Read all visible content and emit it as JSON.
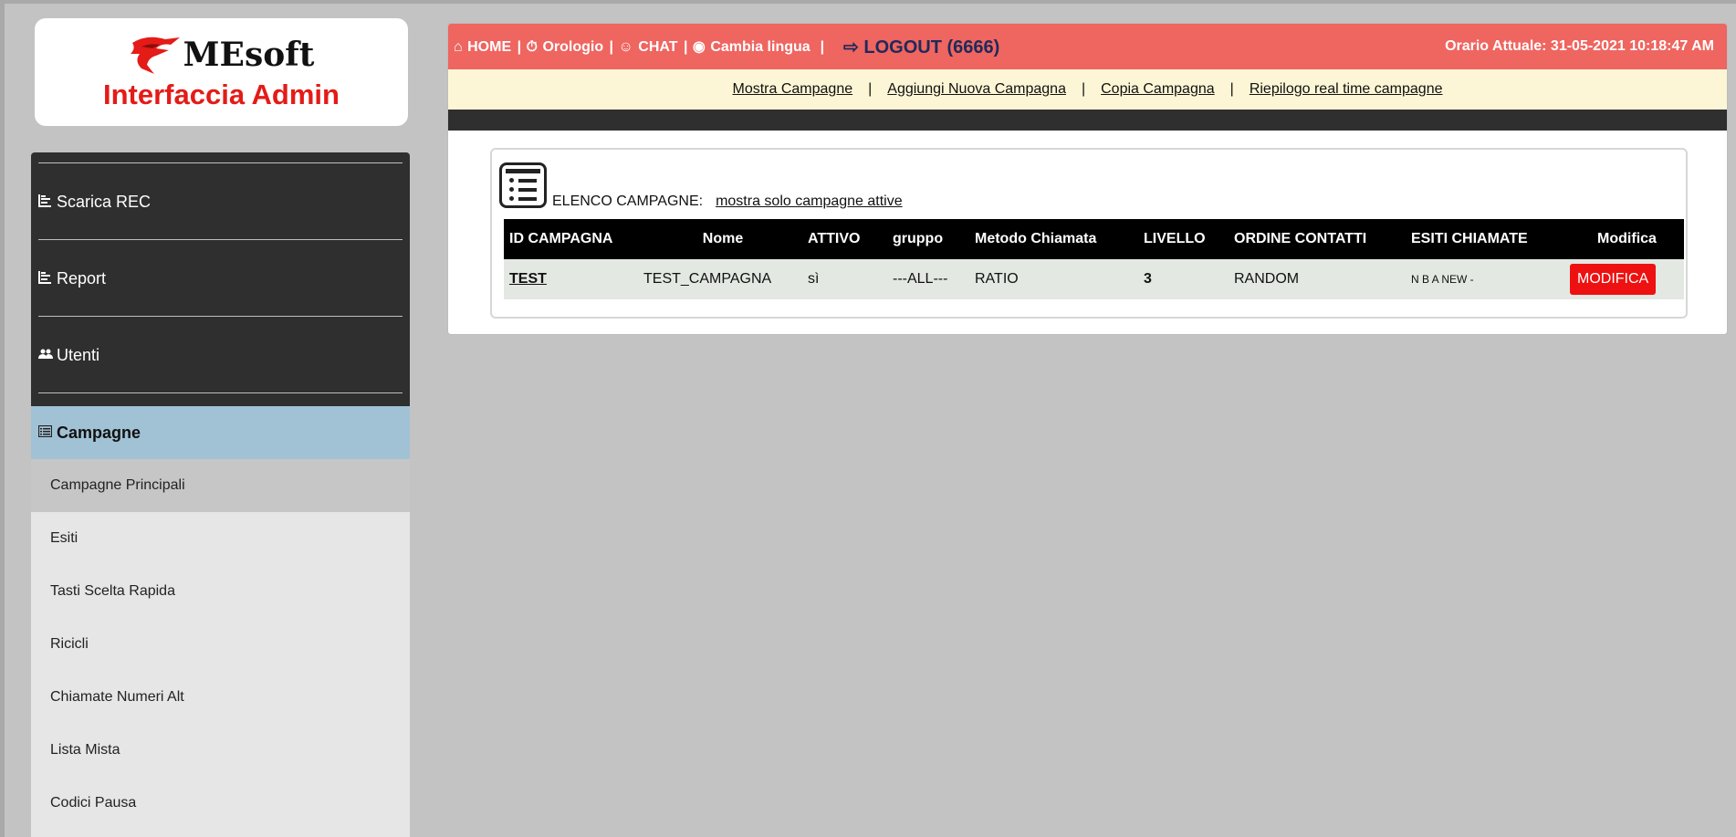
{
  "logo": {
    "brand": "MEsoft",
    "subtitle": "Interfaccia Admin"
  },
  "sidebar": {
    "items": [
      {
        "icon": "chart-icon",
        "label": "Scarica REC"
      },
      {
        "icon": "chart-icon",
        "label": "Report"
      },
      {
        "icon": "users-icon",
        "label": "Utenti"
      }
    ],
    "active": {
      "icon": "list-icon",
      "label": "Campagne"
    },
    "submenu": [
      {
        "label": "Campagne Principali",
        "selected": true
      },
      {
        "label": "Esiti"
      },
      {
        "label": "Tasti Scelta Rapida"
      },
      {
        "label": "Ricicli"
      },
      {
        "label": "Chiamate Numeri Alt"
      },
      {
        "label": "Lista Mista"
      },
      {
        "label": "Codici Pausa"
      }
    ]
  },
  "topbar": {
    "home": "HOME",
    "clock": "Orologio",
    "chat": "CHAT",
    "language": "Cambia lingua",
    "logout": "LOGOUT (6666)",
    "current_time": "Orario Attuale: 31-05-2021 10:18:47 AM"
  },
  "subnav": {
    "show": "Mostra Campagne",
    "add": "Aggiungi Nuova Campagna",
    "copy": "Copia Campagna",
    "summary": "Riepilogo real time campagne",
    "separator": "|"
  },
  "list": {
    "title": "ELENCO CAMPAGNE:",
    "filter": "mostra solo campagne attive",
    "columns": [
      "ID CAMPAGNA",
      "Nome",
      "ATTIVO",
      "gruppo",
      "Metodo Chiamata",
      "LIVELLO",
      "ORDINE CONTATTI",
      "ESITI CHIAMATE",
      "Modifica"
    ],
    "rows": [
      {
        "id": "TEST",
        "name": "TEST_CAMPAGNA",
        "active": "sì",
        "group": "---ALL---",
        "method": "RATIO",
        "level": "3",
        "order": "RANDOM",
        "outcomes": "N B A NEW -",
        "action": "MODIFICA"
      }
    ]
  },
  "colors": {
    "topbar": "#ef6560",
    "accent": "#e41b17",
    "active_menu": "#a1c2d5",
    "logout": "#1e2a5a"
  }
}
